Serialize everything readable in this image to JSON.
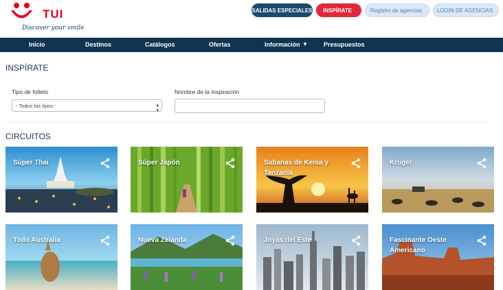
{
  "brand": {
    "name": "TUI",
    "tagline": "Discover your smile",
    "color": "#e3001b"
  },
  "top_buttons": {
    "salidas": "SALIDAS ESPECIALES",
    "inspirate": "INSPÍRATE",
    "registro": "Registro de agencias",
    "login": "LOGIN DE AGENCIAS"
  },
  "nav": {
    "items": [
      "Inicio",
      "Destinos",
      "Catálogos",
      "Ofertas",
      "Información",
      "Presupuestos"
    ],
    "caret": "▼"
  },
  "inspirate": {
    "title": "INSPÍRATE",
    "tipo_label": "Tipo de folleto",
    "tipo_value": "- Todos los tipos -",
    "nombre_label": "Nombre de la inspiración",
    "nombre_value": ""
  },
  "circuitos": {
    "title": "CIRCUITOS",
    "cards": [
      {
        "title": "Súper Thai"
      },
      {
        "title": "Súper Japón"
      },
      {
        "title": "Sabanas de Kenia y Tanzania"
      },
      {
        "title": "Kruger"
      },
      {
        "title": "Todo Australia"
      },
      {
        "title": "Nueva Zelanda"
      },
      {
        "title": "Joyas del Este"
      },
      {
        "title": "Fascinante Oeste Americano"
      }
    ]
  },
  "colors": {
    "nav_bg": "#0e3450",
    "accent_red": "#e3263a",
    "button_dark": "#1b4a70"
  }
}
